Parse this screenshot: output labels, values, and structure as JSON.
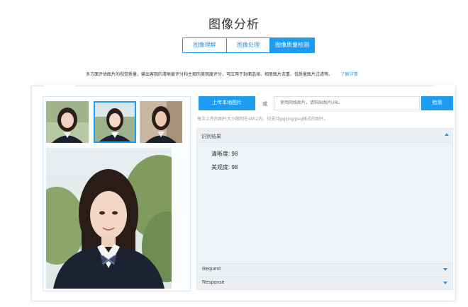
{
  "page": {
    "title": "图像分析",
    "tabs": [
      {
        "label": "图像理解",
        "active": false
      },
      {
        "label": "图像处理",
        "active": false
      },
      {
        "label": "图像质量检测",
        "active": true
      }
    ],
    "description": "多方面评估图片的视觉质量，输出客观的清晰度评分和主观的美观度评分，可应用于封面选择、相册图片去重、低质量图片过滤等。",
    "learn_more": "了解详情"
  },
  "upload": {
    "button_label": "上传本地图片",
    "or_text": "或",
    "url_placeholder": "使用网络图片，请粘贴图片URL",
    "detect_label": "检测",
    "hint": "每次上传的图片大小限制在4M以内，仅支持jpg/png/jpeg格式的图片。"
  },
  "result": {
    "header": "识别结果",
    "scores": [
      {
        "label": "清晰度: 98"
      },
      {
        "label": "美观度: 98"
      }
    ]
  },
  "accordions": {
    "request": "Request",
    "response": "Response"
  },
  "colors": {
    "accent": "#1e9cf0",
    "panel_bg": "#eff4f8"
  }
}
